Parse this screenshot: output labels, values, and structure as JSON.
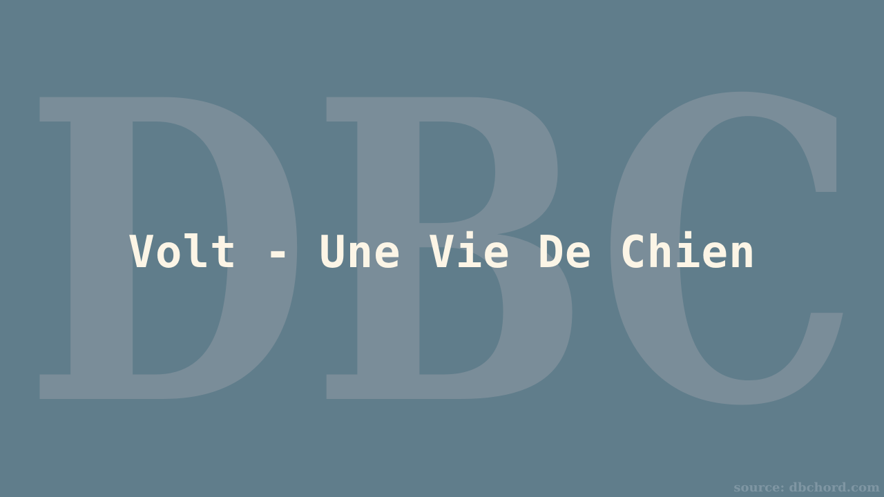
{
  "watermark": {
    "logo_text": "DBC",
    "color": "#7a8d99"
  },
  "title": "Volt - Une Vie De Chien",
  "source": "source: dbchord.com",
  "colors": {
    "background": "#607d8b",
    "title": "#fcf5e6",
    "source": "#7f96a3"
  }
}
